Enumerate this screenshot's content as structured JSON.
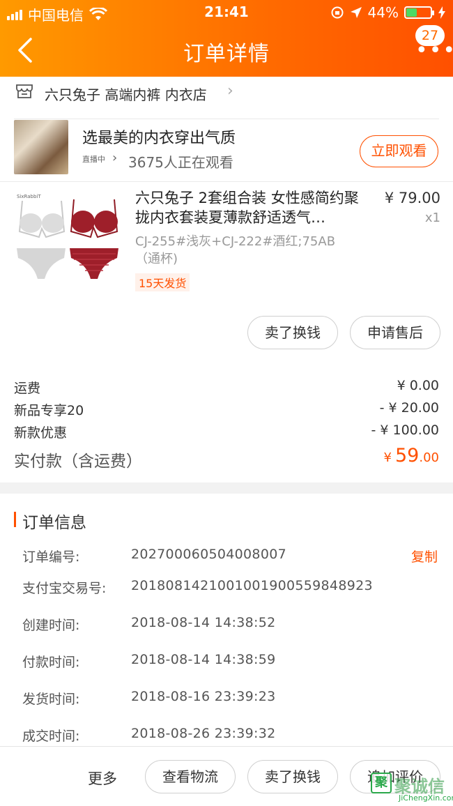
{
  "status_bar": {
    "carrier": "中国电信",
    "time": "21:41",
    "battery_percent": "44%",
    "battery_level": 0.44
  },
  "nav": {
    "title": "订单详情",
    "badge_count": "27"
  },
  "shop": {
    "name": "六只兔子 高端内裤 内衣店"
  },
  "live": {
    "title": "选最美的内衣穿出气质",
    "tag": "直播中",
    "watching": "3675人正在观看",
    "watch_button": "立即观看"
  },
  "product": {
    "title": "六只兔子 2套组合装 女性感简约聚拢内衣套装夏薄款舒适透气…",
    "price": "¥ 79.00",
    "quantity": "x1",
    "sku": "CJ-255#浅灰+CJ-222#酒红;75AB（通杯)",
    "ship_tag": "15天发货",
    "image_brand": "SixRabbiT",
    "actions": [
      "卖了换钱",
      "申请售后"
    ]
  },
  "fees": [
    {
      "label": "运费",
      "value": "¥ 0.00"
    },
    {
      "label": "新品专享20",
      "value": "- ¥ 20.00"
    },
    {
      "label": "新款优惠",
      "value": "- ¥ 100.00"
    }
  ],
  "payment": {
    "label": "实付款（含运费）",
    "currency": "¥",
    "integer": "59",
    "decimal": ".00"
  },
  "order_info": {
    "title": "订单信息",
    "copy_label": "复制",
    "rows": [
      {
        "label": "订单编号:",
        "value": "202700060504008007"
      },
      {
        "label": "支付宝交易号:",
        "value": "2018081421001001900559848923"
      },
      {
        "label": "创建时间:",
        "value": "2018-08-14 14:38:52"
      },
      {
        "label": "付款时间:",
        "value": "2018-08-14 14:38:59"
      },
      {
        "label": "发货时间:",
        "value": "2018-08-16 23:39:23"
      },
      {
        "label": "成交时间:",
        "value": "2018-08-26 23:39:32"
      }
    ]
  },
  "bottom_bar": {
    "more": "更多",
    "buttons": [
      "查看物流",
      "卖了换钱",
      "追加评价"
    ]
  },
  "watermark": {
    "logo": "聚",
    "text": "聚诚信",
    "url": "JiChengXin.com"
  },
  "colors": {
    "accent": "#ff5000",
    "header_start": "#ff9a00",
    "header_end": "#ff5000"
  }
}
